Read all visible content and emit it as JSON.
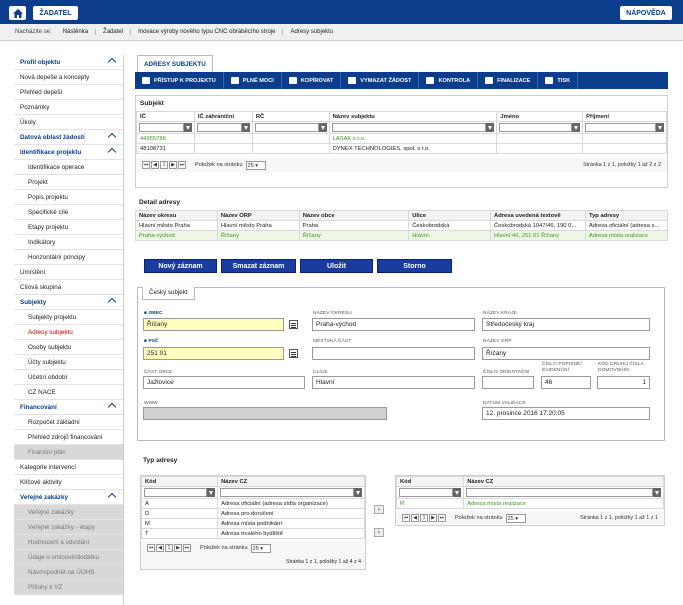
{
  "topbar": {
    "zadatel": "ŽADATEL",
    "napoveda": "NÁPOVĚDA"
  },
  "breadcrumb": {
    "label": "Nacházíte se:",
    "items": [
      "Nástěnka",
      "Žadatel",
      "Inovace výroby nového typu CNC obráběcího stroje",
      "Adresy subjektu"
    ]
  },
  "sidebar": {
    "items": [
      {
        "label": "Profil objektu",
        "kind": "head",
        "chev": true
      },
      {
        "label": "Nová depeše a koncepty",
        "kind": "item"
      },
      {
        "label": "Přehled depeší",
        "kind": "item"
      },
      {
        "label": "Poznámky",
        "kind": "item"
      },
      {
        "label": "Úkoly",
        "kind": "item"
      },
      {
        "label": "Datová oblast žádosti",
        "kind": "head",
        "chev": true
      },
      {
        "label": "Identifikace projektu",
        "kind": "head",
        "chev": true
      },
      {
        "label": "Identifikace operace",
        "kind": "sub"
      },
      {
        "label": "Projekt",
        "kind": "sub"
      },
      {
        "label": "Popis projektu",
        "kind": "sub"
      },
      {
        "label": "Specifické cíle",
        "kind": "sub"
      },
      {
        "label": "Etapy projektu",
        "kind": "sub"
      },
      {
        "label": "Indikátory",
        "kind": "sub"
      },
      {
        "label": "Horizontální principy",
        "kind": "sub"
      },
      {
        "label": "Umístění",
        "kind": "item"
      },
      {
        "label": "Cílová skupina",
        "kind": "item"
      },
      {
        "label": "Subjekty",
        "kind": "head",
        "chev": true
      },
      {
        "label": "Subjekty projektu",
        "kind": "sub"
      },
      {
        "label": "Adresy subjektu",
        "kind": "active"
      },
      {
        "label": "Osoby subjektu",
        "kind": "sub"
      },
      {
        "label": "Účty subjektu",
        "kind": "sub"
      },
      {
        "label": "Účetní období",
        "kind": "sub"
      },
      {
        "label": "CZ NACE",
        "kind": "sub"
      },
      {
        "label": "Financování",
        "kind": "head",
        "chev": true
      },
      {
        "label": "Rozpočet základní",
        "kind": "sub"
      },
      {
        "label": "Přehled zdrojů financování",
        "kind": "sub"
      },
      {
        "label": "Finanční plán",
        "kind": "dis"
      },
      {
        "label": "Kategorie intervencí",
        "kind": "item"
      },
      {
        "label": "Klíčové aktivity",
        "kind": "item"
      },
      {
        "label": "Veřejné zakázky",
        "kind": "head",
        "chev": true
      },
      {
        "label": "Veřejné zakázky",
        "kind": "dis"
      },
      {
        "label": "Veřejné zakázky - etapy",
        "kind": "dis"
      },
      {
        "label": "Hodnocení a odvolání",
        "kind": "dis"
      },
      {
        "label": "Údaje o smlouvě/dodatku",
        "kind": "dis"
      },
      {
        "label": "Návrh/podnět na ÚOHS",
        "kind": "dis"
      },
      {
        "label": "Přílohy k VZ",
        "kind": "dis"
      }
    ]
  },
  "tab": "ADRESY SUBJEKTU",
  "toolbar": [
    "PŘÍSTUP K PROJEKTU",
    "PLNÉ MOCI",
    "KOPÍROVAT",
    "VYMAZAT ŽÁDOST",
    "KONTROLA",
    "FINALIZACE",
    "TISK"
  ],
  "subjekt": {
    "title": "Subjekt",
    "columns": [
      "IČ",
      "IČ zahraniční",
      "RČ",
      "Název subjektu",
      "Jméno",
      "Příjmení"
    ],
    "rows": [
      [
        "44265786",
        "",
        "",
        "LASAK s.r.o.",
        "",
        ""
      ],
      [
        "48108731",
        "",
        "",
        "DYNEX TECHNOLOGIES, spol. s r.o.",
        "",
        ""
      ]
    ],
    "pager": {
      "page": "1",
      "per_page_label": "Položek na stránku",
      "per_page": "25",
      "info": "Stránka 1 z 1, položky 1 až 2 z 2"
    }
  },
  "detail": {
    "title": "Detail adresy",
    "columns": [
      "Název okresu",
      "Název ORP",
      "Název obce",
      "Ulice",
      "Adresa uvedená textově",
      "Typ adresy"
    ],
    "rows": [
      [
        "Hlavní město Praha",
        "Hlavní město Praha",
        "Praha",
        "Českobrodská",
        "Českobrodská 1047/46, 190 0...",
        "Adresa oficiální (adresa s..."
      ],
      [
        "Praha-východ",
        "Říčany",
        "Říčany",
        "Hlavní",
        "Hlavní 46, 251 01 Říčany",
        "Adresa místa realizace"
      ]
    ]
  },
  "buttons": {
    "new": "Nový záznam",
    "delete": "Smazat záznam",
    "save": "Uložit",
    "cancel": "Storno"
  },
  "form": {
    "tab": "Český subjekt",
    "obec_label": "OBEC",
    "obec": "Říčany",
    "okres_label": "NÁZEV OKRESU",
    "okres": "Praha-východ",
    "kraj_label": "NÁZEV KRAJE",
    "kraj": "Středočeský kraj",
    "psc_label": "PSČ",
    "psc": "251 01",
    "mestska_label": "MĚSTSKÁ ČÁST",
    "mestska": "",
    "orp_label": "NÁZEV ORP",
    "orp": "Říčany",
    "cast_label": "ČÁST OBCE",
    "cast": "Jažlovice",
    "ulice_label": "ULICE",
    "ulice": "Hlavní",
    "orient_label": "ČÍSLO ORIENTAČNÍ",
    "orient": "",
    "popisne_label": "ČÍSLO POPISNÉ/ EVIDENČNÍ",
    "popisne": "46",
    "kod_label": "KÓD DRUHU ČÍSLA DOMOVNÍHO",
    "kod": "1",
    "www_label": "WWW",
    "www": "",
    "datum_label": "DATUM VALIDACE",
    "datum": "12. prosince 2016 17:20:05"
  },
  "typ": {
    "title": "Typ adresy",
    "left_columns": [
      "Kód",
      "Název CZ"
    ],
    "left_rows": [
      [
        "A",
        "Adresa oficiální (adresa sídla organizace)"
      ],
      [
        "D",
        "Adresa pro doručení"
      ],
      [
        "M",
        "Adresa místa podnikání"
      ],
      [
        "T",
        "Adresa trvalého bydliště"
      ]
    ],
    "left_pager": {
      "page": "1",
      "per_page_label": "Položek na stránku",
      "per_page": "25",
      "info": "Stránka 1 z 1, položky 1 až 4 z 4"
    },
    "right_columns": [
      "Kód",
      "Název CZ"
    ],
    "right_rows": [
      [
        "R",
        "Adresa místa realizace"
      ]
    ],
    "right_pager": {
      "page": "1",
      "per_page_label": "Položek na stránku",
      "per_page": "25",
      "info": "Stránka 1 z 1, položky 1 až 1 z 1"
    }
  }
}
